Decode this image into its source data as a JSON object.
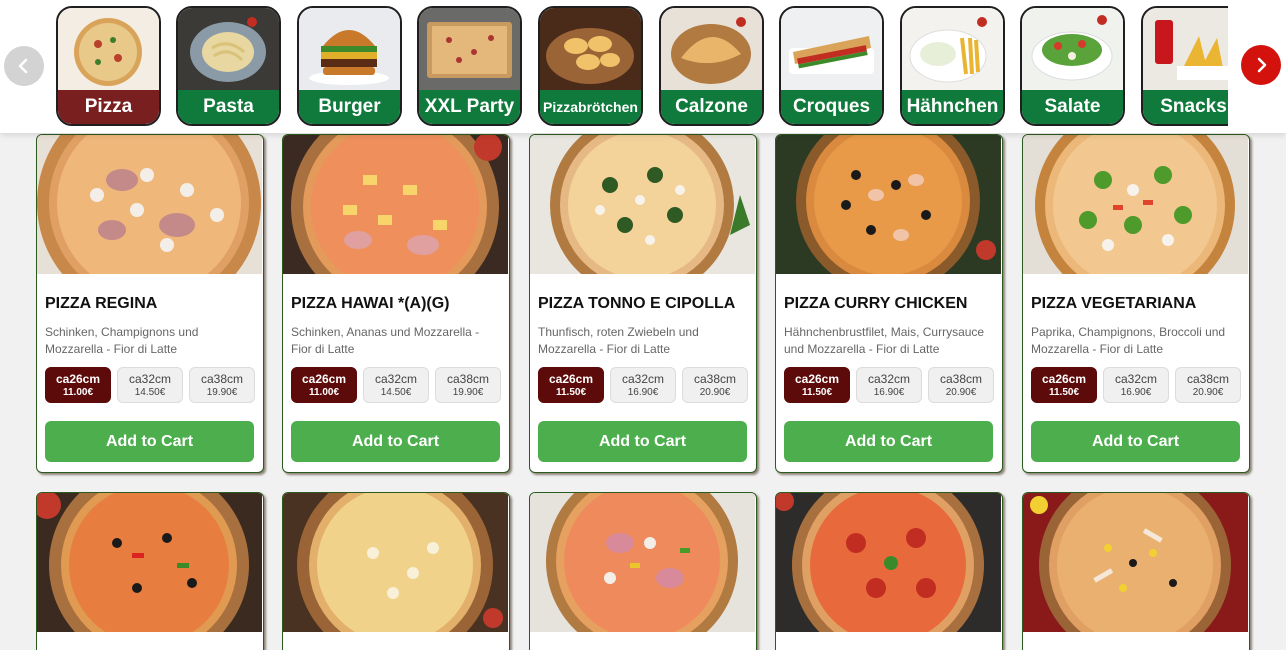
{
  "categories": [
    {
      "label": "Pizza",
      "color": "#7a1f1f",
      "active": true
    },
    {
      "label": "Pasta",
      "color": "#0f7a3c"
    },
    {
      "label": "Burger",
      "color": "#0f7a3c"
    },
    {
      "label": "XXL Party",
      "color": "#0f7a3c"
    },
    {
      "label": "Pizzabrötchen",
      "color": "#0f7a3c"
    },
    {
      "label": "Calzone",
      "color": "#0f7a3c"
    },
    {
      "label": "Croques",
      "color": "#0f7a3c"
    },
    {
      "label": "Hähnchen",
      "color": "#0f7a3c"
    },
    {
      "label": "Salate",
      "color": "#0f7a3c"
    },
    {
      "label": "Snacks",
      "color": "#0f7a3c"
    }
  ],
  "products": [
    {
      "name": "PIZZA REGINA",
      "desc": "Schinken, Champignons und Mozzarella - Fior di Latte",
      "sizes": [
        {
          "size": "ca26cm",
          "price": "11.00€"
        },
        {
          "size": "ca32cm",
          "price": "14.50€"
        },
        {
          "size": "ca38cm",
          "price": "19.90€"
        }
      ],
      "add": "Add to Cart"
    },
    {
      "name": "PIZZA HAWAI *(A)(G)",
      "desc": "Schinken, Ananas und Mozzarella - Fior di Latte",
      "sizes": [
        {
          "size": "ca26cm",
          "price": "11.00€"
        },
        {
          "size": "ca32cm",
          "price": "14.50€"
        },
        {
          "size": "ca38cm",
          "price": "19.90€"
        }
      ],
      "add": "Add to Cart"
    },
    {
      "name": "PIZZA TONNO E CIPOLLA",
      "desc": "Thunfisch, roten Zwiebeln und Mozzarella - Fior di Latte",
      "sizes": [
        {
          "size": "ca26cm",
          "price": "11.50€"
        },
        {
          "size": "ca32cm",
          "price": "16.90€"
        },
        {
          "size": "ca38cm",
          "price": "20.90€"
        }
      ],
      "add": "Add to Cart"
    },
    {
      "name": "PIZZA CURRY CHICKEN",
      "desc": "Hähnchenbrustfilet, Mais, Currysauce und Mozzarella - Fior di Latte",
      "sizes": [
        {
          "size": "ca26cm",
          "price": "11.50€"
        },
        {
          "size": "ca32cm",
          "price": "16.90€"
        },
        {
          "size": "ca38cm",
          "price": "20.90€"
        }
      ],
      "add": "Add to Cart"
    },
    {
      "name": "PIZZA VEGETARIANA",
      "desc": "Paprika, Champignons, Broccoli und Mozzarella - Fior di Latte",
      "sizes": [
        {
          "size": "ca26cm",
          "price": "11.50€"
        },
        {
          "size": "ca32cm",
          "price": "16.90€"
        },
        {
          "size": "ca38cm",
          "price": "20.90€"
        }
      ],
      "add": "Add to Cart"
    }
  ],
  "colors": {
    "accent_green": "#4cae4c",
    "active_size": "#5c0a0a",
    "nav_red": "#d3120e"
  }
}
